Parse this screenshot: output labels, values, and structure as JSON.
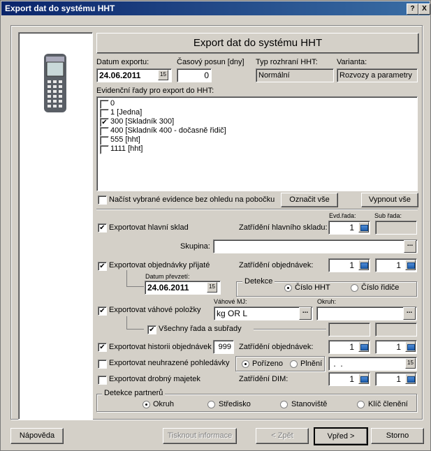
{
  "window": {
    "title": "Export dat do systému HHT",
    "help_btn": "?",
    "close_btn": "X"
  },
  "header": {
    "title": "Export dat do systému HHT"
  },
  "export_date": {
    "label": "Datum exportu:",
    "value": "24.06.2011"
  },
  "time_shift": {
    "label": "Časový posun [dny]",
    "value": "0"
  },
  "interface_type": {
    "label": "Typ rozhraní HHT:",
    "value": "Normální"
  },
  "variant": {
    "label": "Varianta:",
    "value": "Rozvozy a parametry"
  },
  "series": {
    "label": "Evidenční řady pro export do HHT:",
    "items": [
      {
        "label": "0",
        "checked": false
      },
      {
        "label": "1 [Jedna]",
        "checked": false
      },
      {
        "label": "300 [Skladník 300]",
        "checked": true
      },
      {
        "label": "400 [Skladník 400 - dočasně řidič]",
        "checked": false
      },
      {
        "label": "555 [hht]",
        "checked": false
      },
      {
        "label": "1111 [hht]",
        "checked": false
      }
    ]
  },
  "load_selected": {
    "label": "Načíst vybrané evidence bez ohledu na pobočku",
    "checked": false
  },
  "select_all_btn": "Označit vše",
  "deselect_all_btn": "Vypnout vše",
  "col_headers": {
    "evd": "Evd.řada:",
    "sub": "Sub řada:"
  },
  "main_store": {
    "label": "Exportovat hlavní sklad",
    "checked": true,
    "assign_label": "Zatřídění hlavního skladu:",
    "evd": "1"
  },
  "group": {
    "label": "Skupina:",
    "value": ""
  },
  "orders_received": {
    "label": "Exportovat objednávky přijaté",
    "checked": true,
    "assign_label": "Zatřídění objednávek:",
    "evd": "1",
    "sub": "1"
  },
  "takeover_date": {
    "label": "Datum převzetí:",
    "value": "24.06.2011"
  },
  "detection": {
    "legend": "Detekce",
    "opt1": "Číslo HHT",
    "opt2": "Číslo řidiče"
  },
  "weight_items": {
    "label": "Exportovat váhové položky",
    "checked": true,
    "unit_label": "Váhové MJ:",
    "unit_value": "kg OR L",
    "area_label": "Okruh:",
    "area_value": ""
  },
  "all_series": {
    "label": "Všechny řada a subřady",
    "checked": true
  },
  "order_history": {
    "label": "Exportovat historii objednávek",
    "checked": true,
    "count": "999",
    "assign_label": "Zatřídění objednávek:",
    "evd": "1",
    "sub": "1"
  },
  "unpaid_invoices": {
    "label": "Exportovat neuhrazené pohledávky",
    "checked": false,
    "opt1": "Pořízeno",
    "opt2": "Plnění",
    "date_value": " .  ."
  },
  "small_assets": {
    "label": "Exportovat drobný majetek",
    "checked": false,
    "assign_label": "Zatřídění DIM:",
    "evd": "1",
    "sub": "1"
  },
  "partner_detection": {
    "legend": "Detekce partnerů",
    "opts": [
      "Okruh",
      "Středisko",
      "Stanoviště",
      "Klíč členění"
    ]
  },
  "footer": {
    "help": "Nápověda",
    "print": "Tisknout informace",
    "back": "< Zpět",
    "next": "Vpřed >",
    "cancel": "Storno"
  }
}
